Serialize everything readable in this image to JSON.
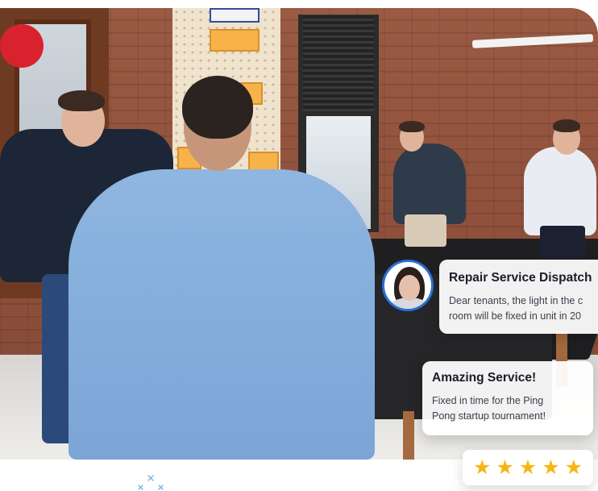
{
  "dispatch_card": {
    "title": "Repair Service Dispatch",
    "message_line1": "Dear tenants, the light in the c",
    "message_line2": "room will be fixed in unit in 20"
  },
  "review_card": {
    "title": "Amazing Service!",
    "message_line1": "Fixed in time for the Ping",
    "message_line2": "Pong startup tournament!"
  },
  "rating": {
    "stars": 5,
    "max": 5,
    "icon": "star-icon",
    "star_color": "#f6b713"
  },
  "colors": {
    "avatar_ring": "#2c6fd6",
    "paddle": "#d8232f",
    "sparkle": "#6fb6e8"
  }
}
